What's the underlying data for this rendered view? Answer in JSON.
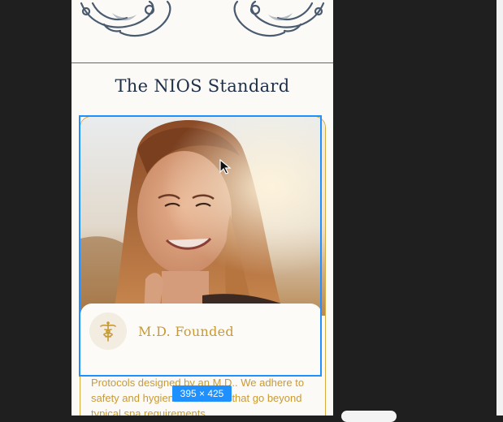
{
  "section": {
    "title": "The NIOS Standard"
  },
  "card": {
    "founder_label": "M.D. Founded",
    "founder_icon": "caduceus-icon",
    "body_text": "Protocols designed by an M.D.. We adhere to safety and hygiene standards that go beyond typical spa requirements."
  },
  "editor": {
    "selection_size": "395 × 425",
    "accent": "#1e90ff"
  },
  "colors": {
    "gold": "#c89a34",
    "navy": "#1e2f48",
    "page": "#fcfaf7"
  }
}
